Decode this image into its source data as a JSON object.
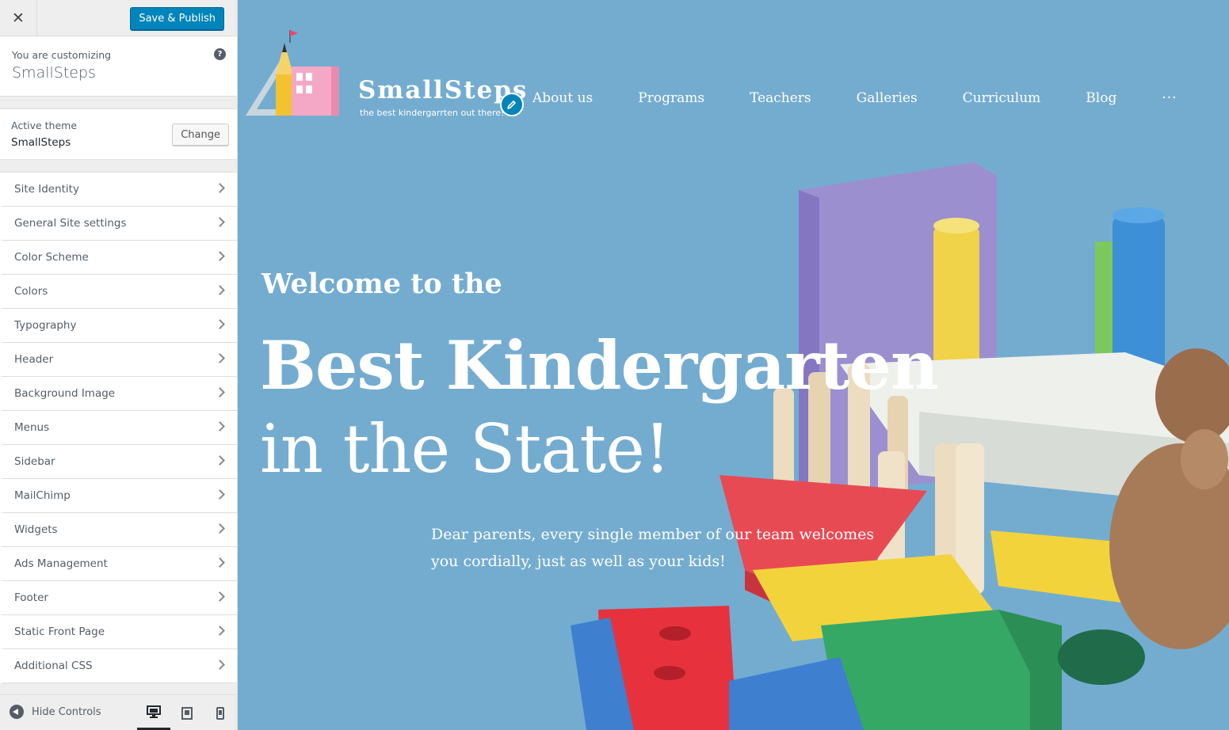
{
  "customizer": {
    "close_icon": "close-icon",
    "save_label": "Save & Publish",
    "info": {
      "label": "You are customizing",
      "site_name": "SmallSteps",
      "help_glyph": "?"
    },
    "theme": {
      "label": "Active theme",
      "name": "SmallSteps",
      "change_label": "Change"
    },
    "sections": [
      {
        "label": "Site Identity"
      },
      {
        "label": "General Site settings"
      },
      {
        "label": "Color Scheme"
      },
      {
        "label": "Colors"
      },
      {
        "label": "Typography"
      },
      {
        "label": "Header"
      },
      {
        "label": "Background Image"
      },
      {
        "label": "Menus"
      },
      {
        "label": "Sidebar"
      },
      {
        "label": "MailChimp"
      },
      {
        "label": "Widgets"
      },
      {
        "label": "Ads Management"
      },
      {
        "label": "Footer"
      },
      {
        "label": "Static Front Page"
      },
      {
        "label": "Additional CSS"
      }
    ],
    "footer": {
      "hide_label": "Hide Controls",
      "devices": [
        "desktop",
        "tablet",
        "mobile"
      ],
      "active_device": "desktop"
    }
  },
  "preview": {
    "site_title": "SmallSteps",
    "tagline": "the best kindergarrten out there!",
    "nav": [
      "About us",
      "Programs",
      "Teachers",
      "Galleries",
      "Curriculum",
      "Blog"
    ],
    "nav_more": "···",
    "hero": {
      "welcome": "Welcome to the",
      "line1": "Best Kindergarten",
      "line2": "in the State!",
      "description_line1": "Dear parents, every single member of our team welcomes",
      "description_line2": "you cordially, just as well as your kids!"
    }
  },
  "colors": {
    "accent": "#0085ba",
    "sidebar_bg": "#eeeeee",
    "preview_bg": "#74acd0"
  }
}
